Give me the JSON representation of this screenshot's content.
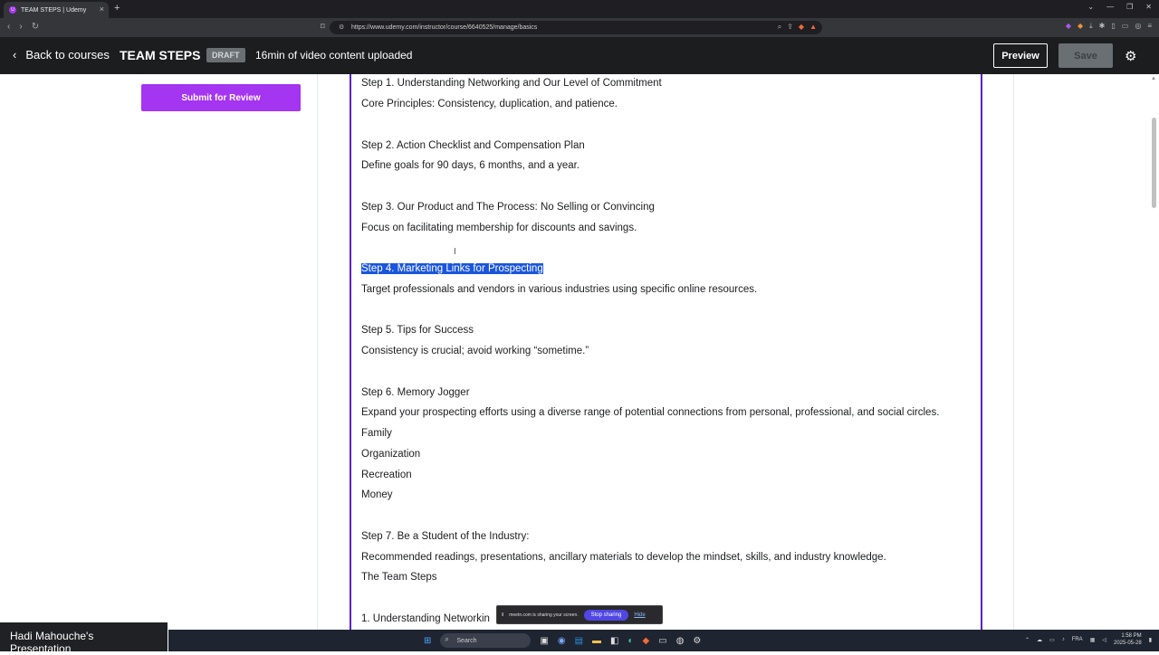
{
  "browser": {
    "tab_title": "TEAM STEPS | Udemy",
    "tab_favicon": "U",
    "url": "https://www.udemy.com/instructor/course/6640525/manage/basics"
  },
  "header": {
    "back_label": "Back to courses",
    "course_title": "TEAM STEPS",
    "status_badge": "DRAFT",
    "video_info": "16min of video content uploaded",
    "preview_label": "Preview",
    "save_label": "Save"
  },
  "sidebar": {
    "submit_label": "Submit for Review"
  },
  "content": {
    "lines": [
      "Step 1. Understanding Networking and Our Level of Commitment",
      "Core Principles: Consistency, duplication, and patience.",
      "Step 2. Action Checklist and Compensation Plan",
      "Define goals for 90 days, 6 months, and a year.",
      "Step 3. Our Product and The Process: No Selling or Convincing",
      "Focus on facilitating membership for discounts and savings.",
      "Step 4. Marketing Links for Prospecting",
      "Target professionals and vendors in various industries using specific online resources.",
      "Step 5. Tips for Success",
      "Consistency is crucial; avoid working “sometime.”",
      "Step 6. Memory Jogger",
      "Expand your prospecting efforts using a diverse range of potential connections from personal, professional, and social circles.",
      "Family",
      "Organization",
      "Recreation",
      "Money",
      "Step 7. Be a Student of the Industry:",
      "Recommended readings, presentations, ancillary materials to develop the mindset, skills, and industry knowledge.",
      "The Team Steps",
      "1. Understanding Networkin"
    ]
  },
  "share_bar": {
    "message": "meetn.com is sharing your screen.",
    "stop_label": "Stop sharing",
    "hide_label": "Hide"
  },
  "presenter": {
    "label": "Hadi Mahouche's Presentation"
  },
  "taskbar": {
    "search_placeholder": "Search",
    "language": "FRA",
    "time": "1:58 PM",
    "date": "2025-05-28"
  },
  "colors": {
    "accent": "#a435f0",
    "editor_border": "#5624d0",
    "header_bg": "#1c1d1f",
    "selection": "#1a56db"
  }
}
